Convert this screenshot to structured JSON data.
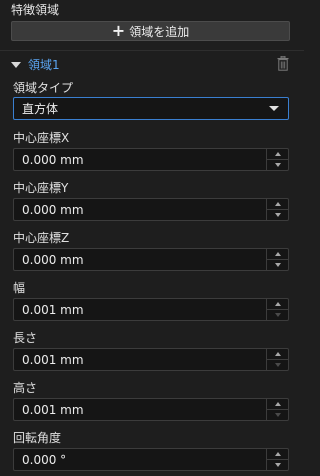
{
  "panel": {
    "section_title": "特徴領域",
    "add_button_label": "領域を追加",
    "region_name": "領域1"
  },
  "region_type": {
    "label": "領域タイプ",
    "value": "直方体"
  },
  "fields": [
    {
      "label": "中心座標X",
      "value": "0.000 mm"
    },
    {
      "label": "中心座標Y",
      "value": "0.000 mm"
    },
    {
      "label": "中心座標Z",
      "value": "0.000 mm"
    },
    {
      "label": "幅",
      "value": "0.001 mm"
    },
    {
      "label": "長さ",
      "value": "0.001 mm"
    },
    {
      "label": "高さ",
      "value": "0.001 mm"
    },
    {
      "label": "回転角度",
      "value": "0.000 °"
    }
  ],
  "colors": {
    "background": "#1e1e1e",
    "accent": "#5aa4f0",
    "select_border": "#3a7fd0"
  }
}
